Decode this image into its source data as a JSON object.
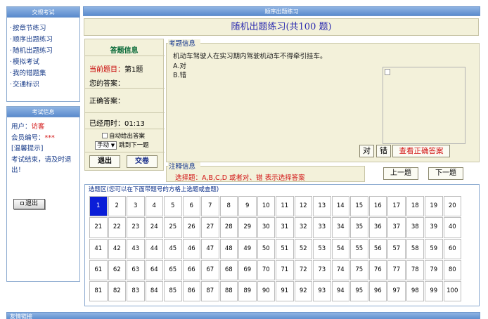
{
  "sidebar_exam": {
    "header": "交规考试",
    "items": [
      "按章节练习",
      "顺序出题练习",
      "随机出题练习",
      "模拟考试",
      "我的错题集",
      "交通标识"
    ],
    "bullet": "·"
  },
  "sidebar_info": {
    "header": "考试信息",
    "user_label": "用户：",
    "user_value": "访客",
    "member_label": "会员编号：",
    "member_value": "***",
    "hint": "[温馨提示]",
    "message": "考试结束，请及时退出！",
    "logout_label": "退出"
  },
  "main": {
    "header": "顺序出题练习",
    "title": "随机出题练习(共100 题)"
  },
  "answer_info": {
    "title": "答题信息",
    "current_label": "当前题目：",
    "current_value": "第1题",
    "your_answer_label": "您的答案：",
    "your_answer_value": "",
    "correct_label": "正确答案：",
    "correct_value": "",
    "elapsed_label": "已经用时：",
    "elapsed_value": "01:13",
    "auto_show_label": "自动给出答案",
    "mode_value": "手动",
    "mode_suffix": "跳到下一题",
    "exit_label": "退出",
    "submit_label": "交卷"
  },
  "question_info": {
    "legend": "考题信息",
    "text": "机动车驾驶人在实习期内驾驶机动车不得牵引挂车。",
    "option_a": "A.对",
    "option_b": "B.错",
    "true_label": "对",
    "false_label": "错",
    "show_answer_label": "查看正确答案"
  },
  "notes": {
    "legend": "注释信息",
    "text": "选择题：A,B,C,D 或者对、错 表示选择答案"
  },
  "nav": {
    "prev_label": "上一题",
    "next_label": "下一题"
  },
  "grid": {
    "label": "选题区(您可以在下面带题号的方格上选题或查题)",
    "numbers": [
      "1",
      "2",
      "3",
      "4",
      "5",
      "6",
      "7",
      "8",
      "9",
      "10",
      "11",
      "12",
      "13",
      "14",
      "15",
      "16",
      "17",
      "18",
      "19",
      "20",
      "21",
      "22",
      "23",
      "24",
      "25",
      "26",
      "27",
      "28",
      "29",
      "30",
      "31",
      "32",
      "33",
      "34",
      "35",
      "36",
      "37",
      "38",
      "39",
      "40",
      "41",
      "42",
      "43",
      "44",
      "45",
      "46",
      "47",
      "48",
      "49",
      "50",
      "51",
      "52",
      "53",
      "54",
      "55",
      "56",
      "57",
      "58",
      "59",
      "60",
      "61",
      "62",
      "63",
      "64",
      "65",
      "66",
      "67",
      "68",
      "69",
      "70",
      "71",
      "72",
      "73",
      "74",
      "75",
      "76",
      "77",
      "78",
      "79",
      "80",
      "81",
      "82",
      "83",
      "84",
      "85",
      "86",
      "87",
      "88",
      "89",
      "90",
      "91",
      "92",
      "93",
      "94",
      "95",
      "96",
      "97",
      "98",
      "99",
      "100"
    ],
    "active_index": 0
  },
  "footer": {
    "label": "友情链接"
  },
  "colors": {
    "header_blue": "#5b8bcd",
    "panel_beige": "#f3f1da",
    "accent_red": "#d21414",
    "active_cell": "#0a1ed8"
  }
}
